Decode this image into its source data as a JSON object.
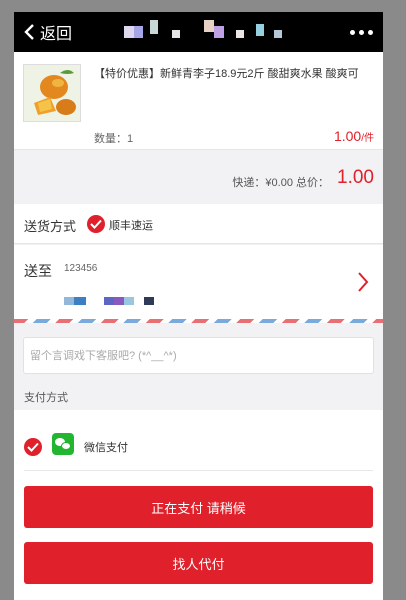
{
  "header": {
    "back_label": "返回",
    "title_blurred_colors": [
      "#ddd8f0",
      "#a6a6e8",
      "#c8d8d6",
      "#e6e6ea",
      "#e6d2c4",
      "#bfa0e4",
      "#ece6e4",
      "#96d0de",
      "#b4c8d8"
    ]
  },
  "product": {
    "title": "【特价优惠】新鲜青李子18.9元2斤 酸甜爽水果 酸爽可",
    "qty_label": "数量：1",
    "price": "1.00",
    "price_unit": "/件"
  },
  "summary": {
    "label": "快递：¥0.00 总价：",
    "total": "1.00"
  },
  "delivery": {
    "label": "送货方式",
    "value": "顺丰速运"
  },
  "address": {
    "label": "送至",
    "phone": "123456",
    "blurred_colors": [
      "#93b7d8",
      "#3d7fc4",
      "#5c67c2",
      "#8a59c0",
      "#98c8e0",
      "#2f3a58"
    ]
  },
  "message": {
    "placeholder": "留个言调戏下客服吧? (*^__^*)"
  },
  "payment": {
    "section_label": "支付方式",
    "option_name": "微信支付",
    "pay_button": "正在支付 请稍候",
    "friend_button": "找人代付"
  },
  "colors": {
    "accent": "#e0202a",
    "wechat_green": "#22b530"
  }
}
